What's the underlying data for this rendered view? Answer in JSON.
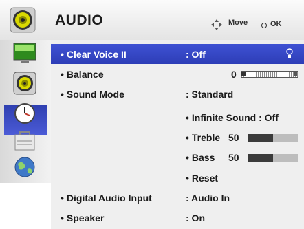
{
  "header": {
    "title": "AUDIO",
    "move_label": "Move",
    "ok_label": "OK"
  },
  "sidebar": {
    "items": [
      {
        "icon": "tv-picture-icon"
      },
      {
        "icon": "speaker-icon",
        "selected": true
      },
      {
        "icon": "clock-icon"
      },
      {
        "icon": "lock-icon"
      },
      {
        "icon": "globe-icon"
      }
    ]
  },
  "menu": {
    "clear_voice": {
      "label": "Clear Voice II",
      "value": ": Off"
    },
    "balance": {
      "label": "Balance",
      "value": "0"
    },
    "sound_mode": {
      "label": "Sound Mode",
      "value": ": Standard"
    },
    "infinite_sound": {
      "label": "Infinite Sound : Off"
    },
    "treble": {
      "label": "Treble",
      "value": "50",
      "fraction": 0.5
    },
    "bass": {
      "label": "Bass",
      "value": "50",
      "fraction": 0.5
    },
    "reset": {
      "label": "Reset"
    },
    "digital_audio": {
      "label": "Digital Audio Input",
      "value": ": Audio In"
    },
    "speaker": {
      "label": "Speaker",
      "value": ": On"
    }
  },
  "colors": {
    "selection": "#3f52d3",
    "panel": "#efefef"
  }
}
